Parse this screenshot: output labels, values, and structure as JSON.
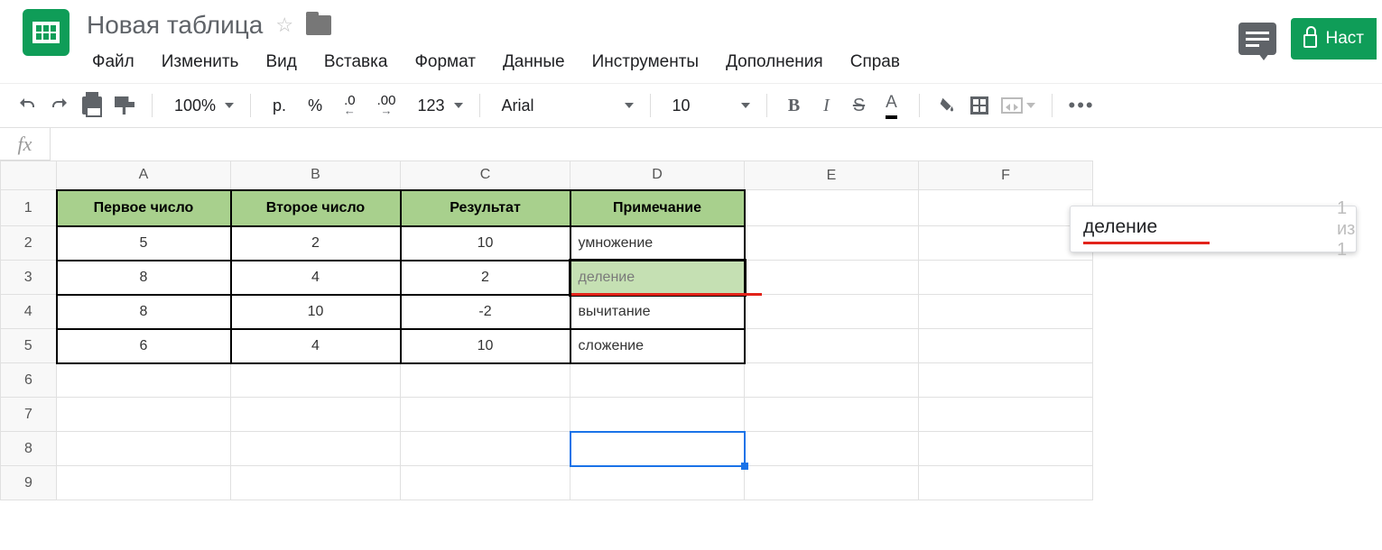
{
  "header": {
    "title": "Новая таблица",
    "menu": [
      "Файл",
      "Изменить",
      "Вид",
      "Вставка",
      "Формат",
      "Данные",
      "Инструменты",
      "Дополнения",
      "Справ"
    ],
    "share_label": "Наст"
  },
  "toolbar": {
    "zoom": "100%",
    "currency": "р.",
    "percent": "%",
    "dec_less": ".0",
    "dec_more": ".00",
    "num_format": "123",
    "font": "Arial",
    "font_size": "10",
    "bold": "B",
    "italic": "I",
    "strike": "S",
    "text_color": "A"
  },
  "formula": {
    "fx": "fx",
    "value": ""
  },
  "columns": [
    "A",
    "B",
    "C",
    "D",
    "E",
    "F"
  ],
  "rows": [
    "1",
    "2",
    "3",
    "4",
    "5",
    "6",
    "7",
    "8",
    "9"
  ],
  "table": {
    "headers": [
      "Первое число",
      "Второе число",
      "Результат",
      "Примечание"
    ],
    "rows": [
      {
        "a": "5",
        "b": "2",
        "c": "10",
        "d": "умножение"
      },
      {
        "a": "8",
        "b": "4",
        "c": "2",
        "d": "деление"
      },
      {
        "a": "8",
        "b": "10",
        "c": "-2",
        "d": "вычитание"
      },
      {
        "a": "6",
        "b": "4",
        "c": "10",
        "d": "сложение"
      }
    ]
  },
  "find": {
    "query": "деление",
    "count": "1 из 1"
  },
  "chart_data": {
    "type": "table",
    "title": "",
    "columns": [
      "Первое число",
      "Второе число",
      "Результат",
      "Примечание"
    ],
    "rows": [
      [
        5,
        2,
        10,
        "умножение"
      ],
      [
        8,
        4,
        2,
        "деление"
      ],
      [
        8,
        10,
        -2,
        "вычитание"
      ],
      [
        6,
        4,
        10,
        "сложение"
      ]
    ]
  }
}
